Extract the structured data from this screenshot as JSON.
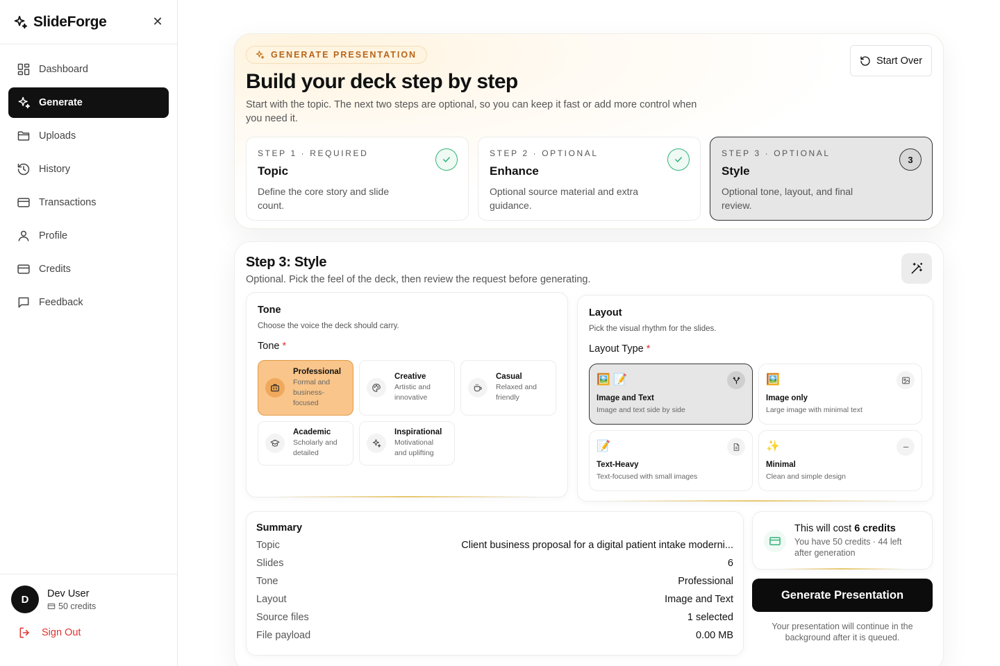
{
  "app": {
    "name": "SlideForge"
  },
  "nav": {
    "items": [
      {
        "label": "Dashboard"
      },
      {
        "label": "Generate"
      },
      {
        "label": "Uploads"
      },
      {
        "label": "History"
      },
      {
        "label": "Transactions"
      },
      {
        "label": "Profile"
      },
      {
        "label": "Credits"
      },
      {
        "label": "Feedback"
      }
    ],
    "active_index": 1
  },
  "user": {
    "initial": "D",
    "name": "Dev User",
    "credits": "50 credits",
    "sign_out": "Sign Out"
  },
  "hero": {
    "badge": "GENERATE PRESENTATION",
    "title": "Build your deck step by step",
    "subtitle": "Start with the topic. The next two steps are optional, so you can keep it fast or add more control when you need it.",
    "start_over": "Start Over"
  },
  "steps": [
    {
      "kicker": "STEP 1 · REQUIRED",
      "title": "Topic",
      "desc": "Define the core story and slide count.",
      "state": "done"
    },
    {
      "kicker": "STEP 2 · OPTIONAL",
      "title": "Enhance",
      "desc": "Optional source material and extra guidance.",
      "state": "done"
    },
    {
      "kicker": "STEP 3 · OPTIONAL",
      "title": "Style",
      "desc": "Optional tone, layout, and final review.",
      "state": "current",
      "number": "3"
    }
  ],
  "style_step": {
    "title": "Step 3: Style",
    "subtitle": "Optional. Pick the feel of the deck, then review the request before generating."
  },
  "tone": {
    "heading": "Tone",
    "desc": "Choose the voice the deck should carry.",
    "field_label": "Tone",
    "required_mark": "*",
    "options": [
      {
        "title": "Professional",
        "desc": "Formal and business-focused",
        "icon": "briefcase-icon",
        "selected": true
      },
      {
        "title": "Creative",
        "desc": "Artistic and innovative",
        "icon": "palette-icon",
        "selected": false
      },
      {
        "title": "Casual",
        "desc": "Relaxed and friendly",
        "icon": "coffee-icon",
        "selected": false
      },
      {
        "title": "Academic",
        "desc": "Scholarly and detailed",
        "icon": "graduation-cap-icon",
        "selected": false
      },
      {
        "title": "Inspirational",
        "desc": "Motivational and uplifting",
        "icon": "sparkles-icon",
        "selected": false
      }
    ]
  },
  "layout": {
    "heading": "Layout",
    "desc": "Pick the visual rhythm for the slides.",
    "field_label": "Layout Type",
    "required_mark": "*",
    "options": [
      {
        "emoji": "🖼️ 📝",
        "title": "Image and Text",
        "desc": "Image and text side by side",
        "icon": "split-icon",
        "selected": true
      },
      {
        "emoji": "🖼️",
        "title": "Image only",
        "desc": "Large image with minimal text",
        "icon": "image-icon",
        "selected": false
      },
      {
        "emoji": "📝",
        "title": "Text-Heavy",
        "desc": "Text-focused with small images",
        "icon": "document-icon",
        "selected": false
      },
      {
        "emoji": "✨",
        "title": "Minimal",
        "desc": "Clean and simple design",
        "icon": "minus-icon",
        "selected": false
      }
    ]
  },
  "summary": {
    "heading": "Summary",
    "rows": [
      {
        "key": "Topic",
        "value": "Client business proposal for a digital patient intake moderni..."
      },
      {
        "key": "Slides",
        "value": "6"
      },
      {
        "key": "Tone",
        "value": "Professional"
      },
      {
        "key": "Layout",
        "value": "Image and Text"
      },
      {
        "key": "Source files",
        "value": "1 selected"
      },
      {
        "key": "File payload",
        "value": "0.00 MB"
      }
    ]
  },
  "cost": {
    "title_prefix": "This will cost ",
    "title_amount": "6 credits",
    "subtitle": "You have 50 credits · 44 left after generation"
  },
  "generate": {
    "button": "Generate Presentation",
    "note": "Your presentation will continue in the background after it is queued."
  },
  "colors": {
    "accent": "#111111",
    "tone_selected": "#f9c58a",
    "success": "#34b27a",
    "danger": "#e0332f",
    "badge": "#b7651a"
  }
}
